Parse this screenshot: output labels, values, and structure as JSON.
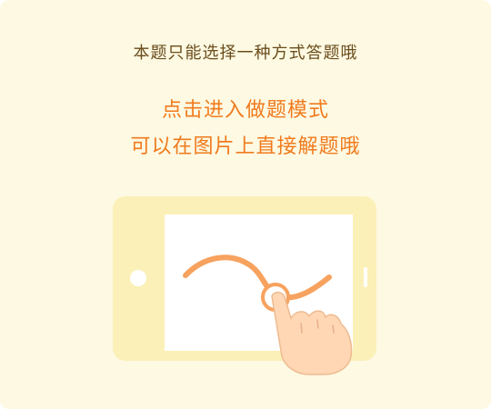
{
  "prompt": {
    "note": "本题只能选择一种方式答题哦",
    "line1": "点击进入做题模式",
    "line2": "可以在图片上直接解题哦"
  },
  "colors": {
    "background": "#fdf9e2",
    "note_text": "#6a4c1c",
    "accent": "#f07b1e",
    "tablet": "#fbf0b8",
    "hand": "#ffd7b4"
  },
  "icons": [
    "tablet-icon",
    "hand-pointer-icon"
  ]
}
